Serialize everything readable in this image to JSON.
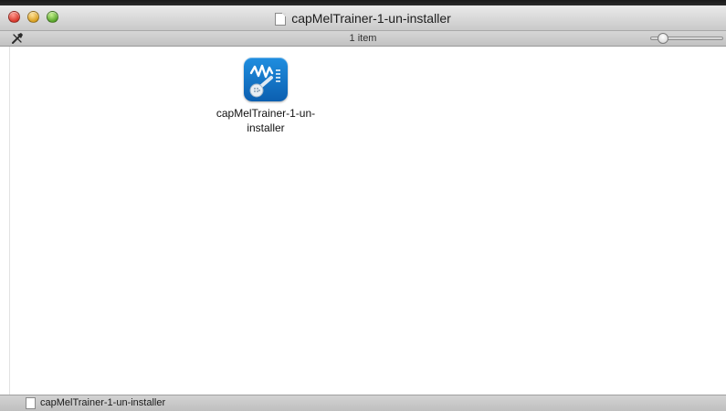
{
  "window": {
    "title": "capMelTrainer-1-un-installer",
    "controls": {
      "close_icon": "close-icon",
      "minimize_icon": "minimize-icon",
      "zoom_icon": "zoom-icon"
    }
  },
  "toolbar": {
    "action_icon": "action-icon",
    "item_count": "1 item",
    "icon_size_slider_level": 0.12
  },
  "content": {
    "items": [
      {
        "name_line1": "capMelTrainer-1-un-",
        "name_line2": "installer",
        "icon": "app-icon-microphone-waveform",
        "icon_color": "#1578c9"
      }
    ]
  },
  "statusbar": {
    "path_item": "capMelTrainer-1-un-installer",
    "icon": "document-icon"
  }
}
